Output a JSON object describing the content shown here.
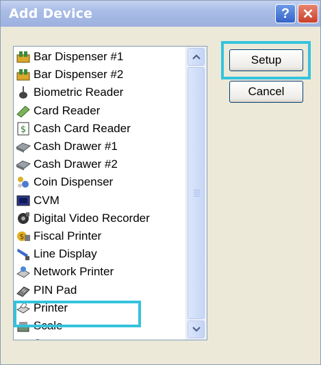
{
  "window": {
    "title": "Add Device"
  },
  "titlebar_buttons": {
    "help": "?",
    "close": "✕"
  },
  "devices": [
    {
      "label": "Bar Dispenser #1",
      "icon": "bar-dispenser-icon"
    },
    {
      "label": "Bar Dispenser #2",
      "icon": "bar-dispenser-icon"
    },
    {
      "label": "Biometric Reader",
      "icon": "biometric-reader-icon"
    },
    {
      "label": "Card Reader",
      "icon": "card-reader-icon"
    },
    {
      "label": "Cash Card Reader",
      "icon": "cash-card-reader-icon"
    },
    {
      "label": "Cash Drawer #1",
      "icon": "cash-drawer-icon"
    },
    {
      "label": "Cash Drawer #2",
      "icon": "cash-drawer-icon"
    },
    {
      "label": "Coin Dispenser",
      "icon": "coin-dispenser-icon"
    },
    {
      "label": "CVM",
      "icon": "cvm-icon"
    },
    {
      "label": "Digital Video Recorder",
      "icon": "video-recorder-icon"
    },
    {
      "label": "Fiscal Printer",
      "icon": "fiscal-printer-icon"
    },
    {
      "label": "Line Display",
      "icon": "line-display-icon"
    },
    {
      "label": "Network Printer",
      "icon": "network-printer-icon"
    },
    {
      "label": "PIN Pad",
      "icon": "pin-pad-icon"
    },
    {
      "label": "Printer",
      "icon": "printer-icon"
    },
    {
      "label": "Scale",
      "icon": "scale-icon"
    },
    {
      "label": "Scanner",
      "icon": "scanner-icon"
    }
  ],
  "buttons": {
    "setup": "Setup",
    "cancel": "Cancel"
  },
  "colors": {
    "highlight": "#34c3dd",
    "title_bar": "#a9bce6",
    "dialog_bg": "#ece9d8"
  }
}
